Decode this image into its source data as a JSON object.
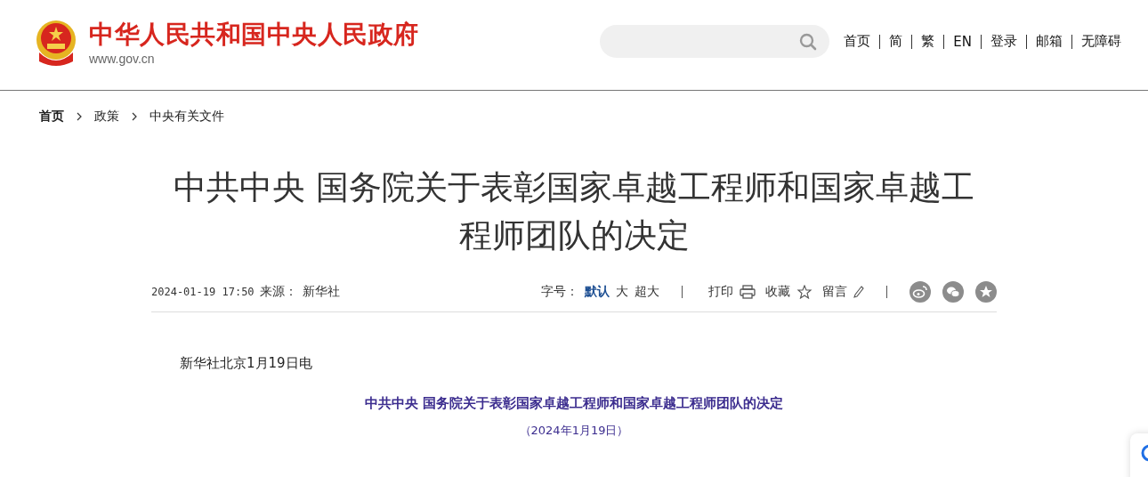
{
  "header": {
    "site_name": "中华人民共和国中央人民政府",
    "site_url": "www.gov.cn",
    "nav": [
      "首页",
      "简",
      "繁",
      "EN",
      "登录",
      "邮箱",
      "无障碍"
    ]
  },
  "breadcrumb": [
    {
      "label": "首页"
    },
    {
      "label": "政策"
    },
    {
      "label": "中央有关文件"
    }
  ],
  "article": {
    "title": "中共中央 国务院关于表彰国家卓越工程师和国家卓越工程师团队的决定",
    "meta": {
      "datetime": "2024-01-19 17:50",
      "source_label": "来源：",
      "source": "新华社"
    },
    "font_size": {
      "label": "字号：",
      "options": [
        {
          "label": "默认",
          "selected": true
        },
        {
          "label": "大",
          "selected": false
        },
        {
          "label": "超大",
          "selected": false
        }
      ]
    },
    "actions": [
      {
        "label": "打印",
        "kind": "print"
      },
      {
        "label": "收藏",
        "kind": "star"
      },
      {
        "label": "留言",
        "kind": "pencil"
      }
    ],
    "share": [
      {
        "kind": "weibo"
      },
      {
        "kind": "wechat"
      },
      {
        "kind": "favorite"
      }
    ],
    "dateline": "新华社北京1月19日电",
    "doc_title": "中共中央 国务院关于表彰国家卓越工程师和国家卓越工程师团队的决定",
    "doc_date": "（2024年1月19日）"
  }
}
